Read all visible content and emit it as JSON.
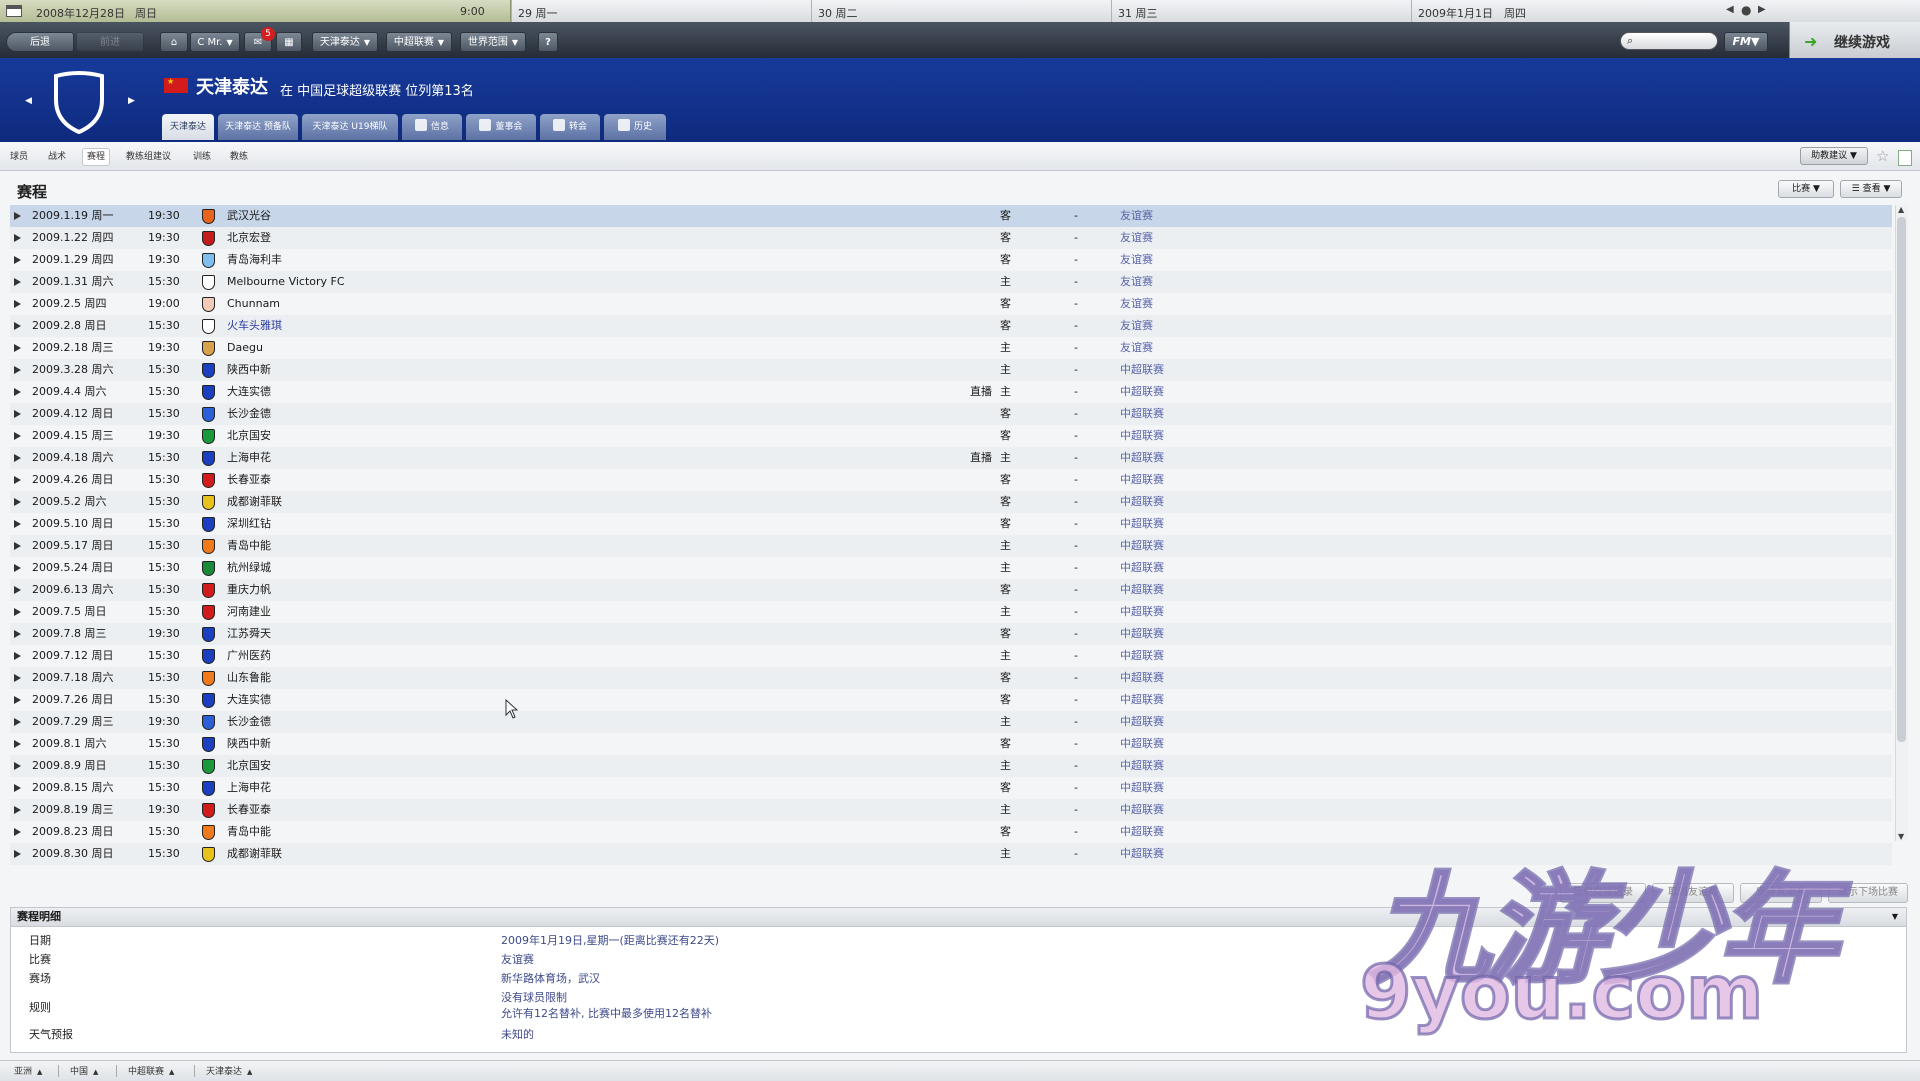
{
  "calendar": {
    "date": "2008年12月28日",
    "weekday": "周日",
    "time": "9:00",
    "days": [
      "29 周一",
      "30 周二",
      "31 周三"
    ],
    "next_date": "2009年1月1日",
    "next_weekday": "周四"
  },
  "toolbar": {
    "back_label": "后退",
    "forward_label": "前进",
    "manager_label": "C Mr.",
    "inbox_count": "5",
    "club_label": "天津泰达",
    "league_label": "中超联赛",
    "world_label": "世界范围",
    "help_label": "?",
    "fm_label": "FM",
    "continue_label": "继续游戏"
  },
  "club": {
    "name": "天津泰达",
    "subtitle": "在 中国足球超级联赛 位列第13名",
    "tabs": [
      "天津泰达",
      "天津泰达 预备队",
      "天津泰达 U19梯队",
      "信息",
      "董事会",
      "转会",
      "历史"
    ]
  },
  "subtabs": [
    "球员",
    "战术",
    "赛程",
    "教练组建议",
    "训练",
    "教练"
  ],
  "subtab_buttons": {
    "assistant_label": "助教建议"
  },
  "fixtures": {
    "title": "赛程",
    "filter_label": "比赛",
    "view_label": "查看",
    "rows": [
      {
        "date": "2009.1.19 周一",
        "time": "19:30",
        "opponent": "武汉光谷",
        "tv": "",
        "venue": "客",
        "result": "-",
        "competition": "友谊赛",
        "color": "#e8631c"
      },
      {
        "date": "2009.1.22 周四",
        "time": "19:30",
        "opponent": "北京宏登",
        "tv": "",
        "venue": "客",
        "result": "-",
        "competition": "友谊赛",
        "color": "#c41c1c"
      },
      {
        "date": "2009.1.29 周四",
        "time": "19:30",
        "opponent": "青岛海利丰",
        "tv": "",
        "venue": "客",
        "result": "-",
        "competition": "友谊赛",
        "color": "#7fbff0"
      },
      {
        "date": "2009.1.31 周六",
        "time": "15:30",
        "opponent": "Melbourne Victory FC",
        "tv": "",
        "venue": "主",
        "result": "-",
        "competition": "友谊赛",
        "color": "#ffffff"
      },
      {
        "date": "2009.2.5 周四",
        "time": "19:00",
        "opponent": "Chunnam",
        "tv": "",
        "venue": "客",
        "result": "-",
        "competition": "友谊赛",
        "color": "#f3c9b8"
      },
      {
        "date": "2009.2.8 周日",
        "time": "15:30",
        "opponent": "火车头雅琪",
        "tv": "",
        "venue": "客",
        "result": "-",
        "competition": "友谊赛",
        "color": "#ffffff"
      },
      {
        "date": "2009.2.18 周三",
        "time": "19:30",
        "opponent": "Daegu",
        "tv": "",
        "venue": "主",
        "result": "-",
        "competition": "友谊赛",
        "color": "#d8a24a"
      },
      {
        "date": "2009.3.28 周六",
        "time": "15:30",
        "opponent": "陕西中新",
        "tv": "",
        "venue": "主",
        "result": "-",
        "competition": "中超联赛",
        "color": "#1a3fbf"
      },
      {
        "date": "2009.4.4 周六",
        "time": "15:30",
        "opponent": "大连实德",
        "tv": "直播",
        "venue": "主",
        "result": "-",
        "competition": "中超联赛",
        "color": "#1a3fbf"
      },
      {
        "date": "2009.4.12 周日",
        "time": "15:30",
        "opponent": "长沙金德",
        "tv": "",
        "venue": "客",
        "result": "-",
        "competition": "中超联赛",
        "color": "#2a5fd8"
      },
      {
        "date": "2009.4.15 周三",
        "time": "19:30",
        "opponent": "北京国安",
        "tv": "",
        "venue": "客",
        "result": "-",
        "competition": "中超联赛",
        "color": "#1a9a3a"
      },
      {
        "date": "2009.4.18 周六",
        "time": "15:30",
        "opponent": "上海申花",
        "tv": "直播",
        "venue": "主",
        "result": "-",
        "competition": "中超联赛",
        "color": "#1a3fbf"
      },
      {
        "date": "2009.4.26 周日",
        "time": "15:30",
        "opponent": "长春亚泰",
        "tv": "",
        "venue": "客",
        "result": "-",
        "competition": "中超联赛",
        "color": "#d21c1c"
      },
      {
        "date": "2009.5.2 周六",
        "time": "15:30",
        "opponent": "成都谢菲联",
        "tv": "",
        "venue": "客",
        "result": "-",
        "competition": "中超联赛",
        "color": "#e8c21c"
      },
      {
        "date": "2009.5.10 周日",
        "time": "15:30",
        "opponent": "深圳红钻",
        "tv": "",
        "venue": "客",
        "result": "-",
        "competition": "中超联赛",
        "color": "#1a3fbf"
      },
      {
        "date": "2009.5.17 周日",
        "time": "15:30",
        "opponent": "青岛中能",
        "tv": "",
        "venue": "主",
        "result": "-",
        "competition": "中超联赛",
        "color": "#f07a1c"
      },
      {
        "date": "2009.5.24 周日",
        "time": "15:30",
        "opponent": "杭州绿城",
        "tv": "",
        "venue": "主",
        "result": "-",
        "competition": "中超联赛",
        "color": "#1a8a3a"
      },
      {
        "date": "2009.6.13 周六",
        "time": "15:30",
        "opponent": "重庆力帆",
        "tv": "",
        "venue": "客",
        "result": "-",
        "competition": "中超联赛",
        "color": "#d21c1c"
      },
      {
        "date": "2009.7.5 周日",
        "time": "15:30",
        "opponent": "河南建业",
        "tv": "",
        "venue": "主",
        "result": "-",
        "competition": "中超联赛",
        "color": "#d21c1c"
      },
      {
        "date": "2009.7.8 周三",
        "time": "19:30",
        "opponent": "江苏舜天",
        "tv": "",
        "venue": "客",
        "result": "-",
        "competition": "中超联赛",
        "color": "#1a3fbf"
      },
      {
        "date": "2009.7.12 周日",
        "time": "15:30",
        "opponent": "广州医药",
        "tv": "",
        "venue": "主",
        "result": "-",
        "competition": "中超联赛",
        "color": "#1a3fbf"
      },
      {
        "date": "2009.7.18 周六",
        "time": "15:30",
        "opponent": "山东鲁能",
        "tv": "",
        "venue": "客",
        "result": "-",
        "competition": "中超联赛",
        "color": "#f07a1c"
      },
      {
        "date": "2009.7.26 周日",
        "time": "15:30",
        "opponent": "大连实德",
        "tv": "",
        "venue": "客",
        "result": "-",
        "competition": "中超联赛",
        "color": "#1a3fbf"
      },
      {
        "date": "2009.7.29 周三",
        "time": "19:30",
        "opponent": "长沙金德",
        "tv": "",
        "venue": "主",
        "result": "-",
        "competition": "中超联赛",
        "color": "#2a5fd8"
      },
      {
        "date": "2009.8.1 周六",
        "time": "15:30",
        "opponent": "陕西中新",
        "tv": "",
        "venue": "客",
        "result": "-",
        "competition": "中超联赛",
        "color": "#1a3fbf"
      },
      {
        "date": "2009.8.9 周日",
        "time": "15:30",
        "opponent": "北京国安",
        "tv": "",
        "venue": "主",
        "result": "-",
        "competition": "中超联赛",
        "color": "#1a9a3a"
      },
      {
        "date": "2009.8.15 周六",
        "time": "15:30",
        "opponent": "上海申花",
        "tv": "",
        "venue": "客",
        "result": "-",
        "competition": "中超联赛",
        "color": "#1a3fbf"
      },
      {
        "date": "2009.8.19 周三",
        "time": "19:30",
        "opponent": "长春亚泰",
        "tv": "",
        "venue": "主",
        "result": "-",
        "competition": "中超联赛",
        "color": "#d21c1c"
      },
      {
        "date": "2009.8.23 周日",
        "time": "15:30",
        "opponent": "青岛中能",
        "tv": "",
        "venue": "客",
        "result": "-",
        "competition": "中超联赛",
        "color": "#f07a1c"
      },
      {
        "date": "2009.8.30 周日",
        "time": "15:30",
        "opponent": "成都谢菲联",
        "tv": "",
        "venue": "主",
        "result": "-",
        "competition": "中超联赛",
        "color": "#e8c21c"
      }
    ]
  },
  "actions": [
    "历史交锋记录",
    "取消友谊赛",
    "安排友谊赛",
    "显示下场比赛"
  ],
  "details": {
    "title": "赛程明细",
    "rows": [
      {
        "key": "日期",
        "value": "2009年1月19日,星期一(距离比赛还有22天)"
      },
      {
        "key": "比赛",
        "value": "友谊赛"
      },
      {
        "key": "赛场",
        "value": "新华路体育场，武汉"
      },
      {
        "key": "规则",
        "value": "没有球员限制"
      },
      {
        "key": "",
        "value": "允许有12名替补, 比赛中最多使用12名替补"
      },
      {
        "key": "天气预报",
        "value": "未知的"
      }
    ]
  },
  "breadcrumbs": [
    "亚洲",
    "中国",
    "中超联赛",
    "天津泰达"
  ],
  "watermark": {
    "line1": "九游少年",
    "line2": "9you.com"
  }
}
